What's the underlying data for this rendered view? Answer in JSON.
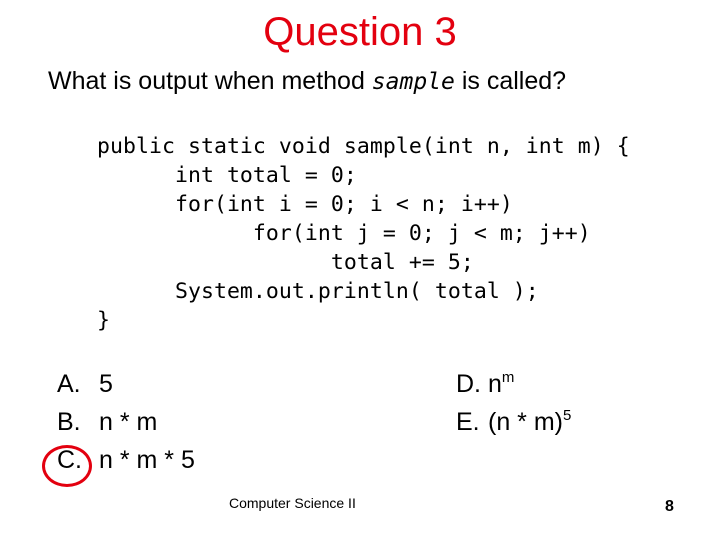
{
  "slide": {
    "title": "Question 3",
    "question": {
      "prefix": "What is output when method ",
      "method_name": "sample",
      "suffix": " is called?"
    },
    "code_lines": [
      "public static void sample(int n, int m) {",
      "      int total = 0;",
      "      for(int i = 0; i < n; i++)",
      "            for(int j = 0; j < m; j++)",
      "                  total += 5;",
      "      System.out.println( total );",
      "}"
    ],
    "answers": [
      {
        "letter": "A.",
        "text": "5",
        "sup": ""
      },
      {
        "letter": "B.",
        "text": "n * m",
        "sup": ""
      },
      {
        "letter": "C.",
        "text": "n * m * 5",
        "sup": ""
      },
      {
        "letter": "D.",
        "text": "n",
        "sup": "m"
      },
      {
        "letter": "E.",
        "text": "(n * m)",
        "sup": "5"
      }
    ],
    "selected_answer": "C.",
    "mark_color": "#e3000f",
    "title_color": "#e3000f",
    "footer": "Computer Science II",
    "page_number": "8"
  }
}
